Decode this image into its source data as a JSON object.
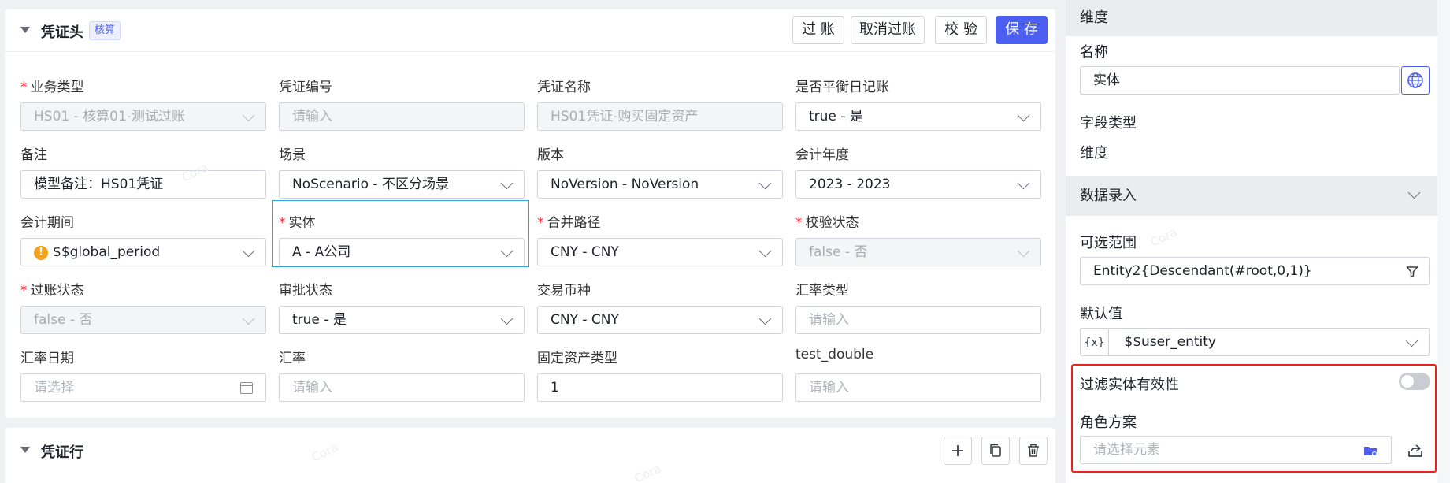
{
  "voucher_header": {
    "title": "凭证头",
    "tag": "核算",
    "buttons": {
      "post": "过 账",
      "unpost": "取消过账",
      "validate": "校 验",
      "save": "保 存"
    },
    "fields": {
      "business_type": {
        "label": "业务类型",
        "value": "HS01 - 核算01-测试过账"
      },
      "voucher_no": {
        "label": "凭证编号",
        "placeholder": "请输入"
      },
      "voucher_name": {
        "label": "凭证名称",
        "value": "HS01凭证-购买固定资产"
      },
      "balance_daily": {
        "label": "是否平衡日记账",
        "value": "true - 是"
      },
      "remark": {
        "label": "备注",
        "value": "模型备注：HS01凭证"
      },
      "scenario": {
        "label": "场景",
        "value": "NoScenario - 不区分场景"
      },
      "version": {
        "label": "版本",
        "value": "NoVersion - NoVersion"
      },
      "fiscal_year": {
        "label": "会计年度",
        "value": "2023 - 2023"
      },
      "period": {
        "label": "会计期间",
        "value": "$$global_period",
        "warn_symbol": "!"
      },
      "entity": {
        "label": "实体",
        "value": "A - A公司"
      },
      "consolidation_path": {
        "label": "合并路径",
        "value": "CNY - CNY"
      },
      "validate_status": {
        "label": "校验状态",
        "value": "false - 否"
      },
      "post_status": {
        "label": "过账状态",
        "value": "false - 否"
      },
      "approval_status": {
        "label": "审批状态",
        "value": "true - 是"
      },
      "currency": {
        "label": "交易币种",
        "value": "CNY - CNY"
      },
      "rate_type": {
        "label": "汇率类型",
        "placeholder": "请输入"
      },
      "rate_date": {
        "label": "汇率日期",
        "placeholder": "请选择"
      },
      "rate": {
        "label": "汇率",
        "placeholder": "请输入"
      },
      "asset_type": {
        "label": "固定资产类型",
        "value": "1"
      },
      "test_double": {
        "label": "test_double",
        "placeholder": "请输入"
      }
    }
  },
  "voucher_lines": {
    "title": "凭证行"
  },
  "right_panel": {
    "dimension_section": "维度",
    "name_label": "名称",
    "name_value": "实体",
    "field_type_label": "字段类型",
    "field_type_value": "维度",
    "data_entry_section": "数据录入",
    "range_label": "可选范围",
    "range_value": "Entity2{Descendant(#root,0,1)}",
    "default_label": "默认值",
    "default_prefix": "{x}",
    "default_value": "$$user_entity",
    "filter_validity_label": "过滤实体有效性",
    "filter_validity_on": false,
    "role_scheme_label": "角色方案",
    "role_scheme_placeholder": "请选择元素"
  },
  "watermark_text": "Cora",
  "colors": {
    "primary": "#4c5ff0",
    "highlight_box": "#e8231d",
    "focus_box": "#2ea7e0",
    "required": "#f5222d"
  }
}
